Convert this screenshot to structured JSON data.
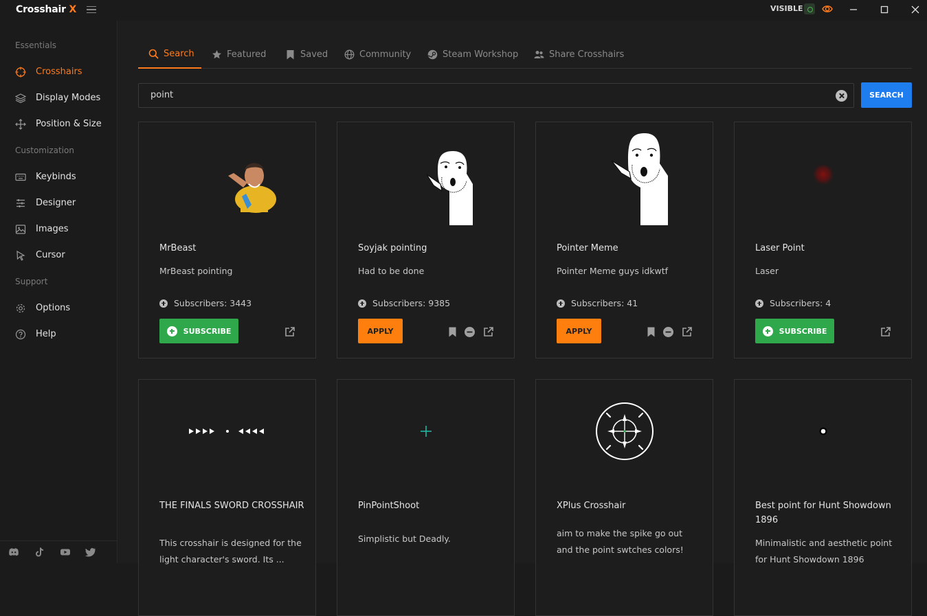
{
  "app": {
    "name": "Crosshair",
    "name_accent": "X",
    "visible_label": "VISIBLE"
  },
  "sidebar": {
    "sections": [
      {
        "label": "Essentials",
        "items": [
          {
            "label": "Crosshairs",
            "icon": "crosshair-icon",
            "active": true
          },
          {
            "label": "Display Modes",
            "icon": "layers-icon"
          },
          {
            "label": "Position & Size",
            "icon": "move-icon"
          }
        ]
      },
      {
        "label": "Customization",
        "items": [
          {
            "label": "Keybinds",
            "icon": "keyboard-icon"
          },
          {
            "label": "Designer",
            "icon": "sliders-icon"
          },
          {
            "label": "Images",
            "icon": "image-icon"
          },
          {
            "label": "Cursor",
            "icon": "cursor-icon"
          }
        ]
      },
      {
        "label": "Support",
        "items": [
          {
            "label": "Options",
            "icon": "gear-icon"
          },
          {
            "label": "Help",
            "icon": "help-icon"
          }
        ]
      }
    ],
    "social": [
      "discord-icon",
      "tiktok-icon",
      "youtube-icon",
      "twitter-icon"
    ]
  },
  "tabs": [
    {
      "label": "Search",
      "icon": "search-icon",
      "active": true
    },
    {
      "label": "Featured",
      "icon": "star-icon"
    },
    {
      "label": "Saved",
      "icon": "bookmark-icon"
    },
    {
      "label": "Community",
      "icon": "globe-icon"
    },
    {
      "label": "Steam Workshop",
      "icon": "steam-icon"
    },
    {
      "label": "Share Crosshairs",
      "icon": "users-icon"
    }
  ],
  "search": {
    "value": "point",
    "button_label": "SEARCH"
  },
  "cards": [
    {
      "name": "MrBeast",
      "description": "MrBeast pointing",
      "subscribers": "Subscribers: 3443",
      "action": "SUBSCRIBE"
    },
    {
      "name": "Soyjak pointing",
      "description": "Had to be done",
      "subscribers": "Subscribers: 9385",
      "action": "APPLY"
    },
    {
      "name": "Pointer Meme",
      "description": "Pointer Meme guys idkwtf",
      "subscribers": "Subscribers: 41",
      "action": "APPLY"
    },
    {
      "name": "Laser Point",
      "description": "Laser",
      "subscribers": "Subscribers: 4",
      "action": "SUBSCRIBE"
    },
    {
      "name": "THE FINALS SWORD CROSSHAIR",
      "description": "This crosshair is designed for the light character's sword. Its ..."
    },
    {
      "name": "PinPointShoot",
      "description": "Simplistic but Deadly."
    },
    {
      "name": "XPlus Crosshair",
      "description": "aim to make the spike go out and the point swtches colors!"
    },
    {
      "name": "Best point for Hunt Showdown 1896",
      "description": "Minimalistic and aesthetic point for Hunt Showdown 1896"
    }
  ],
  "colors": {
    "accent": "#ff7b1c",
    "search_button": "#1e7ef0",
    "subscribe": "#2ea84a",
    "apply": "#ff7f0e"
  }
}
